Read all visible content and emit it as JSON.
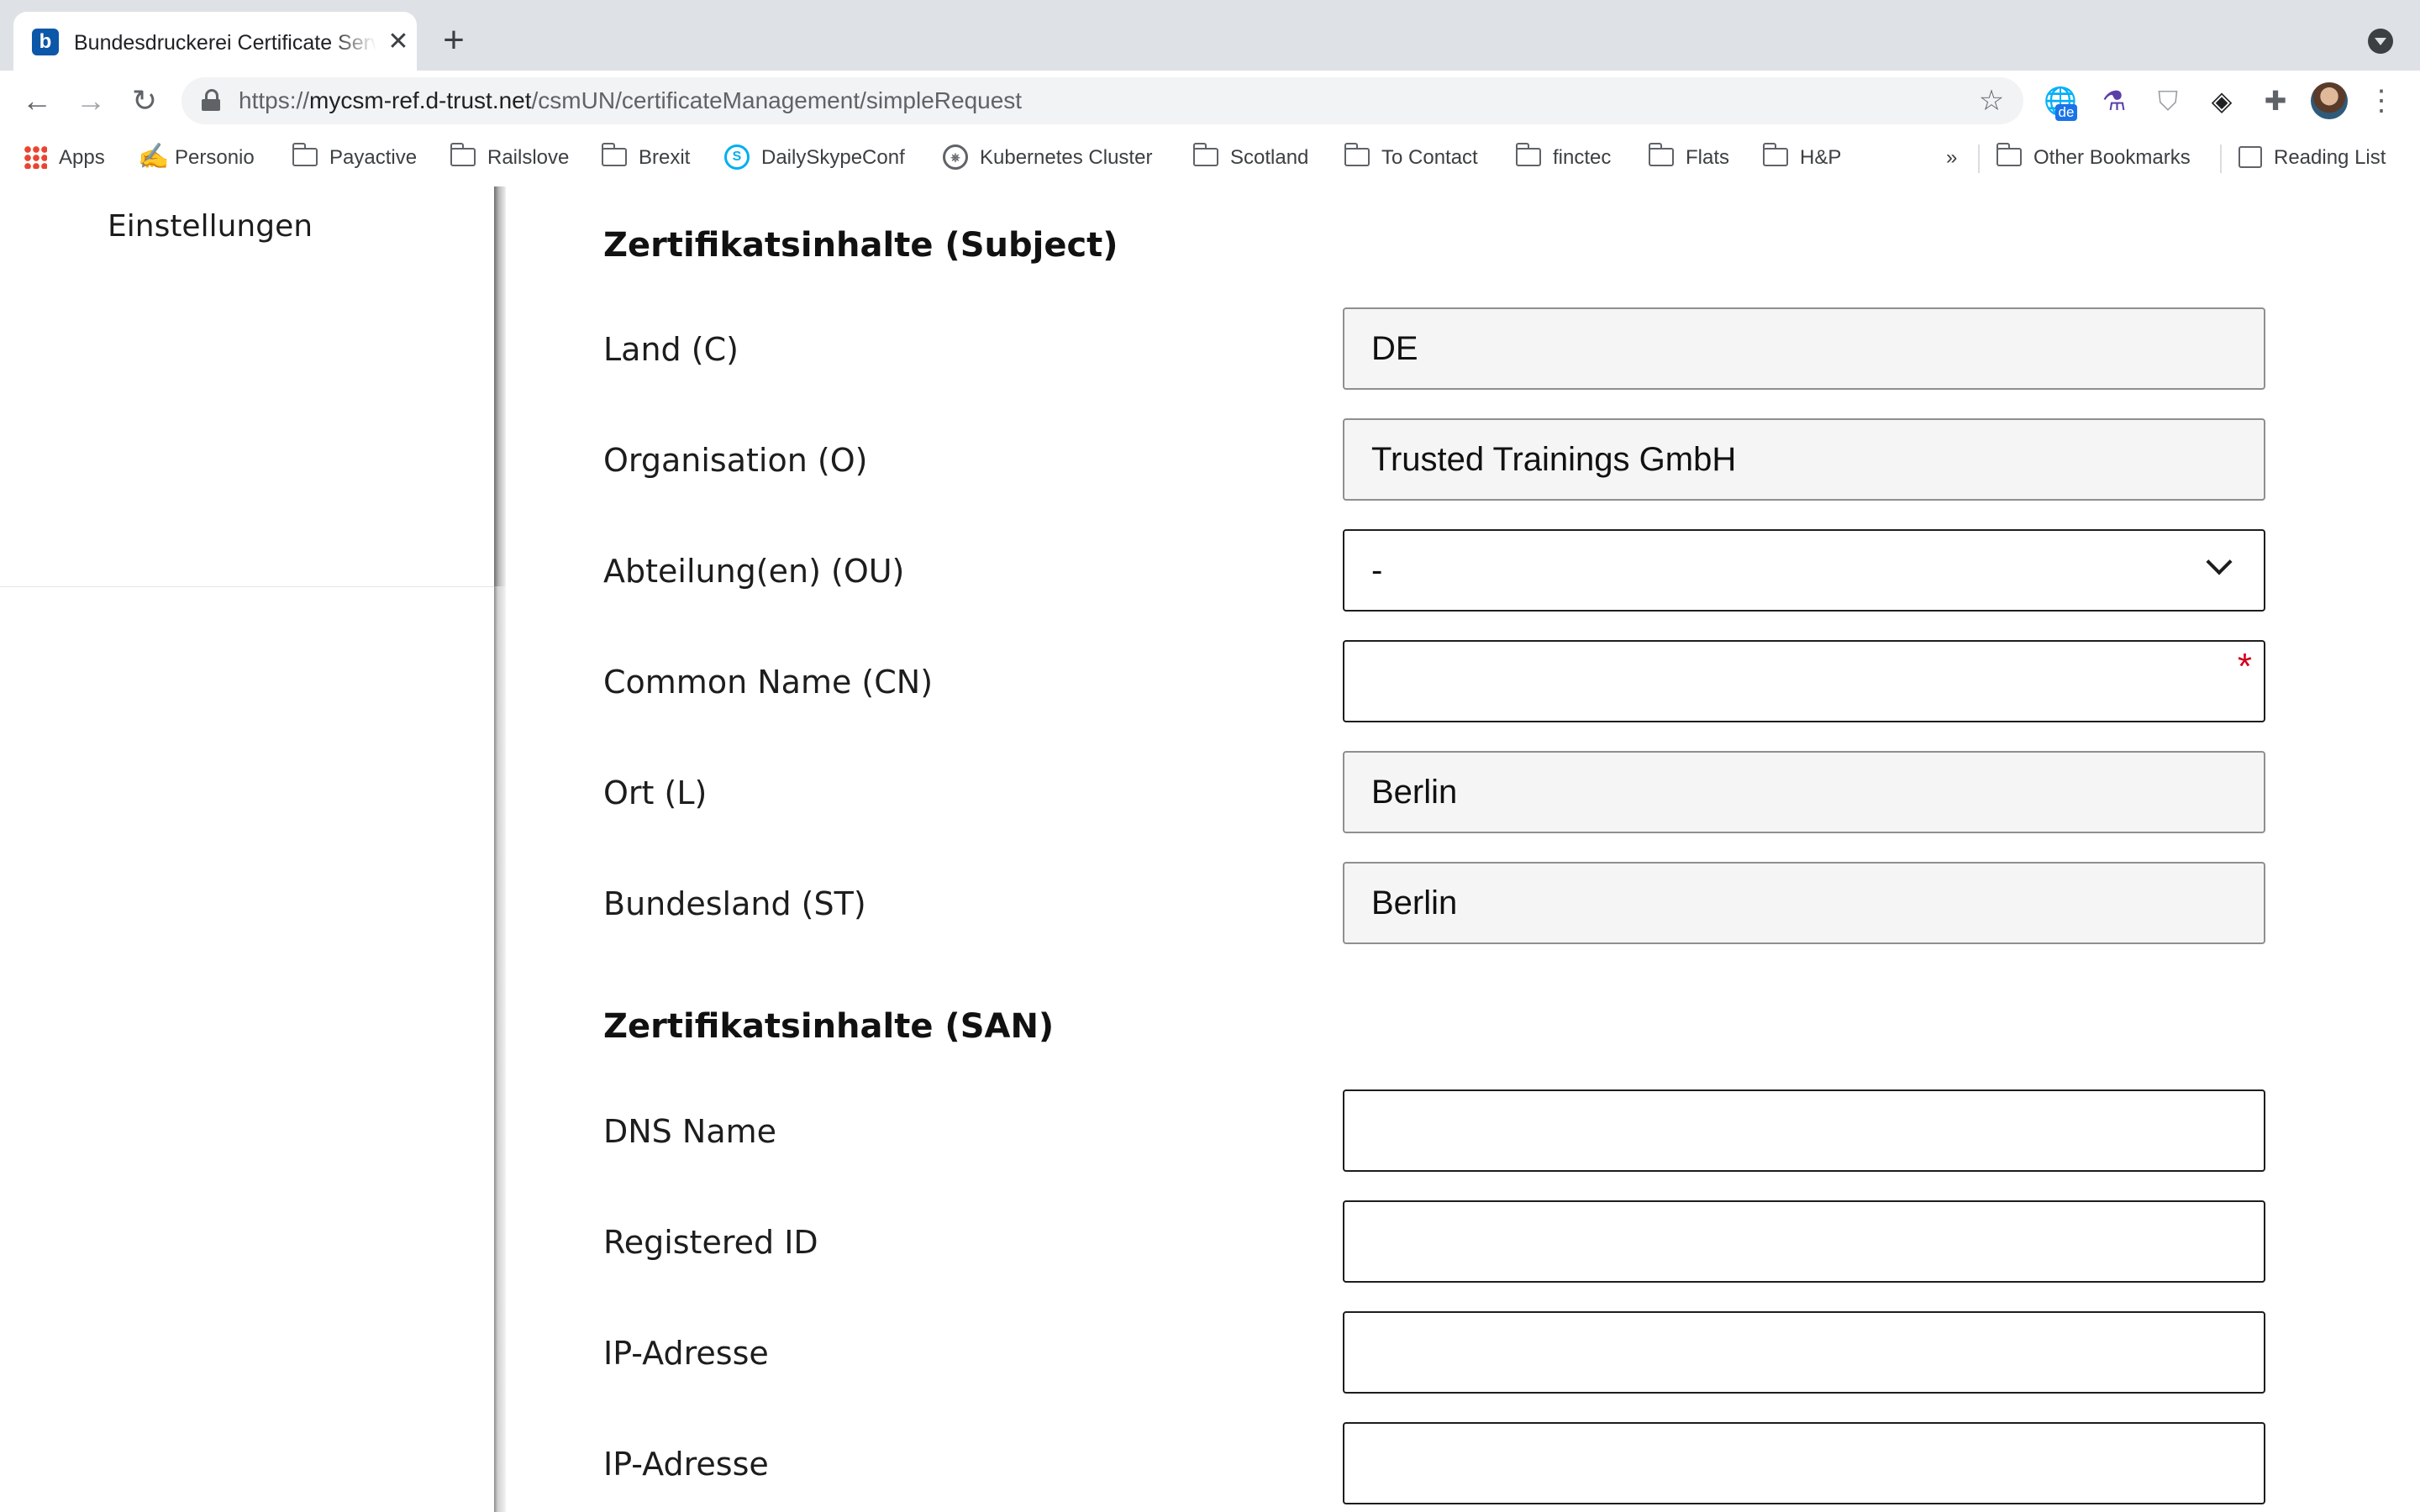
{
  "browser": {
    "tab_title": "Bundesdruckerei Certificate Service",
    "favicon_letter": "b",
    "url_scheme": "https://",
    "url_host": "mycsm-ref.d-trust.net",
    "url_path": "/csmUN/certificateManagement/simpleRequest",
    "language_badge": "de",
    "new_tab_glyph": "+",
    "close_glyph": "✕"
  },
  "bookmarks": {
    "items": [
      {
        "label": "Apps",
        "icon": "apps-icon"
      },
      {
        "label": "Personio",
        "icon": "personio-icon"
      },
      {
        "label": "Payactive",
        "icon": "folder-icon"
      },
      {
        "label": "Railslove",
        "icon": "folder-icon"
      },
      {
        "label": "Brexit",
        "icon": "folder-icon"
      },
      {
        "label": "DailySkypeConf",
        "icon": "skype-icon"
      },
      {
        "label": "Kubernetes Cluster",
        "icon": "kubernetes-icon"
      },
      {
        "label": "Scotland",
        "icon": "folder-icon"
      },
      {
        "label": "To Contact",
        "icon": "folder-icon"
      },
      {
        "label": "finctec",
        "icon": "folder-icon"
      },
      {
        "label": "Flats",
        "icon": "folder-icon"
      },
      {
        "label": "H&P",
        "icon": "folder-icon"
      }
    ],
    "overflow": "»",
    "other": "Other Bookmarks",
    "reading_list": "Reading List"
  },
  "sidebar": {
    "settings_label": "Einstellungen"
  },
  "form": {
    "subject_title": "Zertifikatsinhalte (Subject)",
    "san_title": "Zertifikatsinhalte (SAN)",
    "subject_fields": [
      {
        "label": "Land (C)",
        "value": "DE",
        "type": "readonly"
      },
      {
        "label": "Organisation (O)",
        "value": "Trusted Trainings GmbH",
        "type": "readonly"
      },
      {
        "label": "Abteilung(en) (OU)",
        "value": "-",
        "type": "select"
      },
      {
        "label": "Common Name (CN)",
        "value": "",
        "type": "required"
      },
      {
        "label": "Ort (L)",
        "value": "Berlin",
        "type": "readonly"
      },
      {
        "label": "Bundesland (ST)",
        "value": "Berlin",
        "type": "readonly"
      }
    ],
    "required_marker": "*",
    "san_fields": [
      {
        "label": "DNS Name",
        "value": ""
      },
      {
        "label": "Registered ID",
        "value": ""
      },
      {
        "label": "IP-Adresse",
        "value": ""
      },
      {
        "label": "IP-Adresse",
        "value": ""
      }
    ]
  }
}
